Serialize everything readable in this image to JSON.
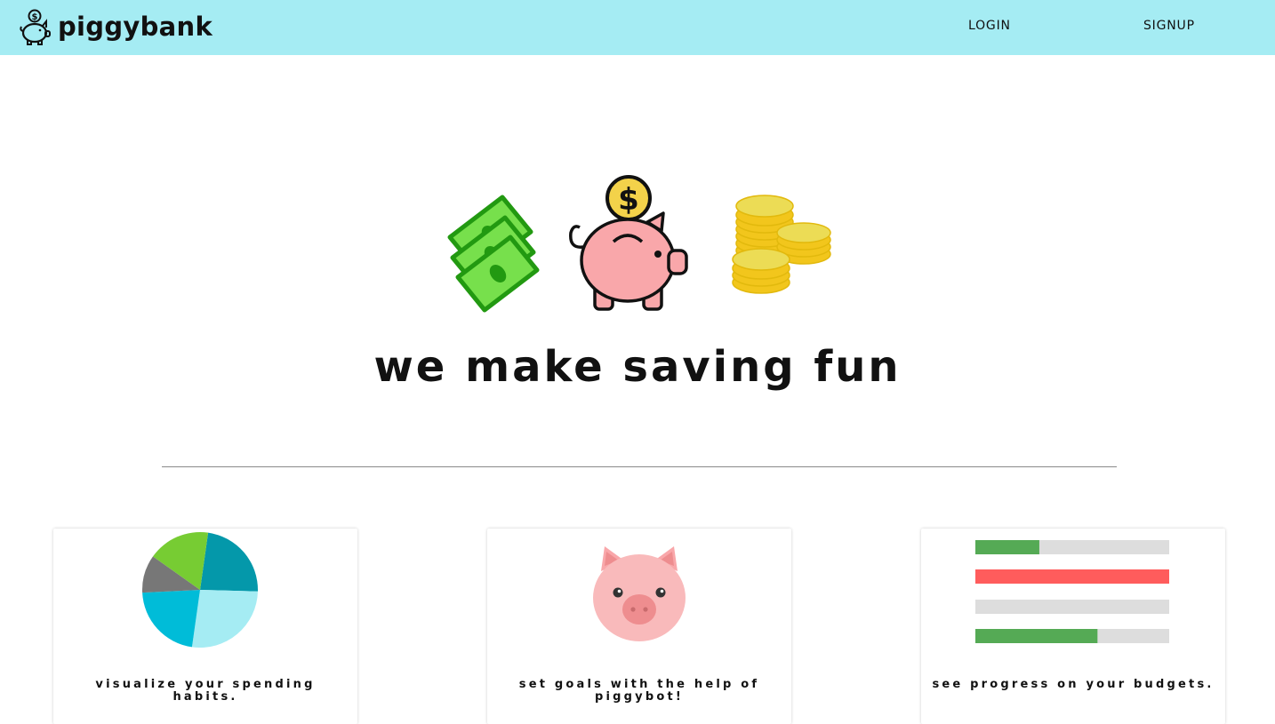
{
  "navbar": {
    "brand_name": "piggybank",
    "links": {
      "login": "LOGIN",
      "signup": "SIGNUP"
    },
    "background_color": "#a5ecf3"
  },
  "hero": {
    "icons": [
      "cash-icon",
      "piggy-bank-coin-icon",
      "coin-stack-icon"
    ],
    "coin_symbol": "$",
    "title": "we make saving fun"
  },
  "features": [
    {
      "icon": "pie-chart-icon",
      "text": "visualize your spending habits."
    },
    {
      "icon": "pig-face-icon",
      "text": "set goals with the help of piggybot!"
    },
    {
      "icon": "progress-bars-icon",
      "text": "see progress on your budgets."
    }
  ],
  "pie_chart": {
    "slice_colors": [
      "#0498aa",
      "#a5ecf3",
      "#00bcd8",
      "#777777",
      "#77cc33"
    ]
  },
  "budget_bars": [
    {
      "fill": 0.33,
      "color": "#55aa55"
    },
    {
      "fill": 1.0,
      "color": "#ff5c5c"
    },
    {
      "fill": 0.0,
      "color": "#dddddd"
    },
    {
      "fill": 0.63,
      "color": "#55aa55"
    }
  ]
}
